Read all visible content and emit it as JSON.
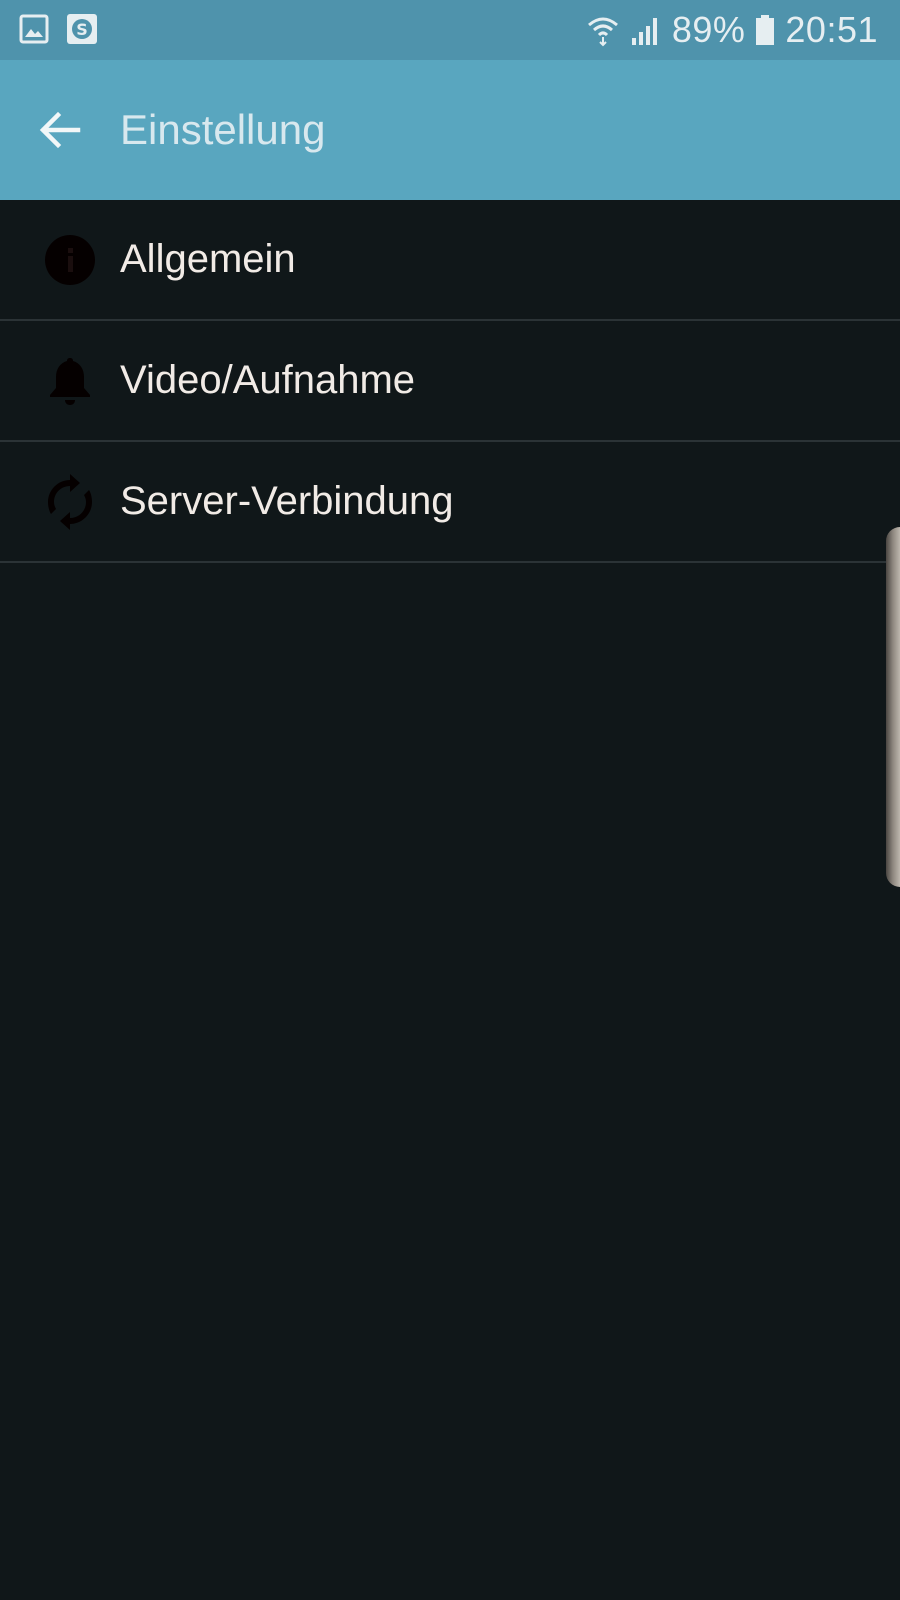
{
  "status_bar": {
    "left_icons": [
      "image-notification-icon",
      "skype-notification-icon"
    ],
    "wifi_icon": "wifi-icon",
    "signal_icon": "signal-icon",
    "battery_percent": "89%",
    "battery_icon": "battery-icon",
    "time": "20:51"
  },
  "app_bar": {
    "title": "Einstellung",
    "back_icon": "arrow-back-icon"
  },
  "settings": {
    "items": [
      {
        "label": "Allgemein",
        "icon": "info-icon"
      },
      {
        "label": "Video/Aufnahme",
        "icon": "bell-icon"
      },
      {
        "label": "Server-Verbindung",
        "icon": "sync-icon"
      }
    ]
  },
  "colors": {
    "status_bar": "#4f93ac",
    "app_bar": "#59a6bf",
    "background": "#101719",
    "divider": "#2b3336",
    "item_text": "#f1ebe6",
    "icon": "#050000"
  }
}
